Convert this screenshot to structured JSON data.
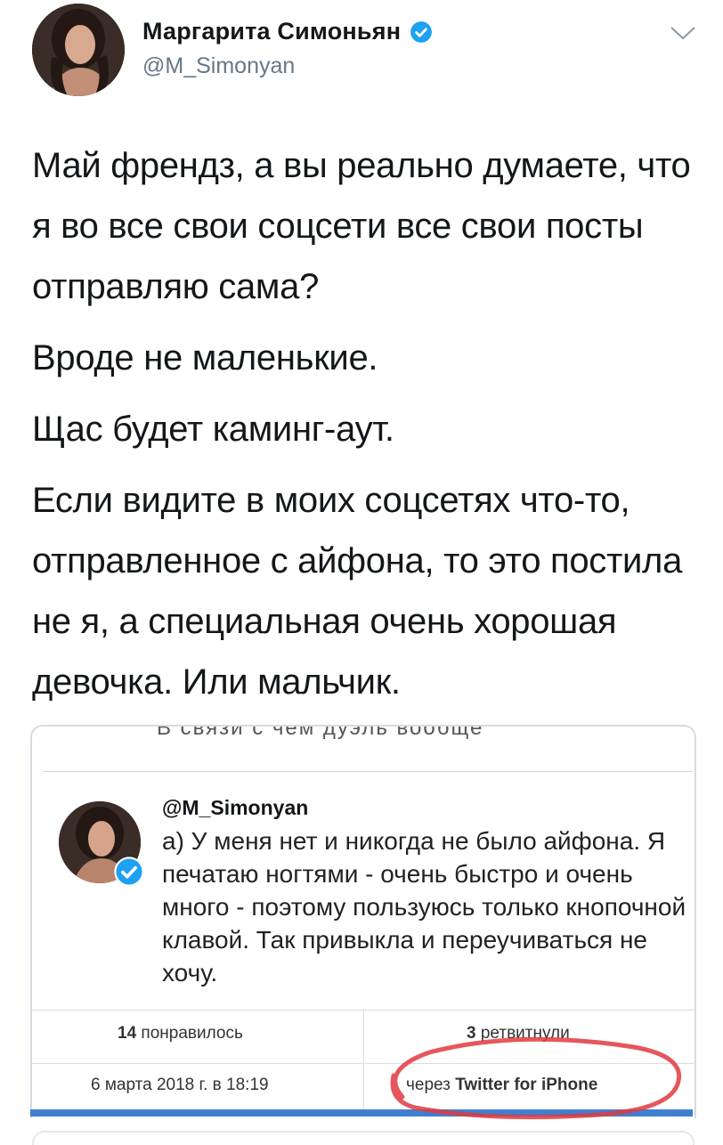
{
  "author": {
    "name": "Маргарита Симоньян",
    "handle": "@M_Simonyan"
  },
  "icons": {
    "avatar": "profile-photo",
    "verified": "verified-badge-icon",
    "menu": "chevron-down-icon"
  },
  "tweet": {
    "paragraphs": [
      "Май френдз, а вы реально думаете, что я во все свои соцсети все свои посты отправляю сама?",
      "Вроде не маленькие.",
      "Щас будет каминг-аут.",
      "Если видите в моих соцсетях что-то, отправленное с айфона, то это постила не я, а специальная очень хорошая девочка. Или мальчик."
    ]
  },
  "quoted": {
    "cut_text": "В связи с чем дуэль вообще",
    "handle": "@M_Simonyan",
    "text": "а) У меня нет и никогда не было айфона. Я печатаю ногтями - очень быстро и очень много - поэтому пользуюсь только кнопочной клавой. Так привыкла и переучиваться не хочу.",
    "likes_count": "14",
    "likes_label": "понравилось",
    "retweets_count": "3",
    "retweets_label": "ретвитнули",
    "date": "6 марта 2018 г. в 18:19",
    "via_prefix": "через",
    "via_source": "Twitter for iPhone"
  },
  "colors": {
    "verified": "#1da1f2",
    "highlight_circle": "#e0393e",
    "bottom_bar": "#3f7fd0"
  }
}
